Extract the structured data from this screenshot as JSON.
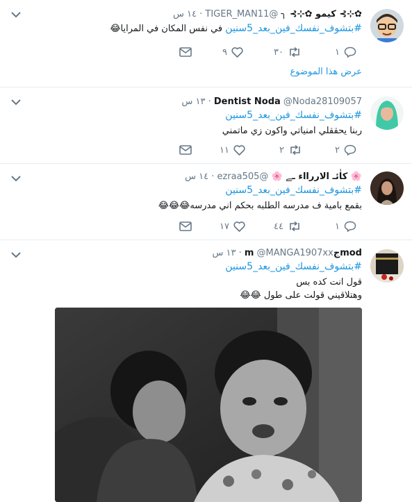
{
  "feed": {
    "tweets": [
      {
        "display_name": "✿⊹⊱ كيمو ✿⊹⊱ ╮",
        "handle": "@TIGER_MAN11",
        "time": "١٤ س",
        "hashtag": "#بتشوف_نفسك_فين_بعد_5سنين",
        "text": "في نفس المكان في المرايا😂",
        "replies": "١",
        "retweets": "٣٠",
        "likes": "٩",
        "thread_link": "عرض هذا الموضوع"
      },
      {
        "display_name": "Dentist Noda",
        "handle": "@Noda28109057",
        "time": "١٣ س",
        "hashtag": "#بتشوف_نفسك_فين_بعد_5سنين",
        "text": "ربنا يحققلي امنياتي واكون زي ماتمني",
        "replies": "٢",
        "retweets": "٢",
        "likes": "١١"
      },
      {
        "display_name": "🌸 كاٰئـ الاررااء ـﮯ 🌸",
        "handle": "@ezraa505",
        "time": "١٤ س",
        "hashtag": "#بتشوف_نفسك_فين_بعد_5سنين",
        "text": "بقمع بامية ف مدرسه الطلبه بحكم اني مدرسه😂😂😂",
        "replies": "١",
        "retweets": "٤٤",
        "likes": "١٧"
      },
      {
        "display_name": "modجm",
        "handle": "@MANGA1907xx",
        "time": "١٣ س",
        "hashtag": "#بتشوف_نفسك_فين_بعد_5سنين",
        "text_line1": "قول انت كده بس",
        "text_line2": "وهتلاقيني قولت على طول 😂😂"
      }
    ]
  },
  "colors": {
    "link": "#1b95e0",
    "secondary": "#657786",
    "divider": "#e6ecf0"
  },
  "icons": [
    "chevron-down-icon",
    "reply-icon",
    "retweet-icon",
    "like-icon",
    "dm-icon"
  ]
}
